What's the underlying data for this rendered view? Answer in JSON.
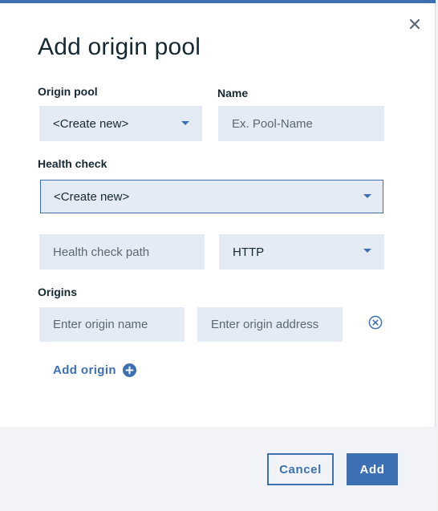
{
  "modal": {
    "title": "Add origin pool",
    "close_icon": "close-icon"
  },
  "form": {
    "origin_pool_label": "Origin pool",
    "origin_pool_value": "<Create new>",
    "name_label": "Name",
    "name_placeholder": "Ex. Pool-Name",
    "health_check_label": "Health check",
    "health_check_value": "<Create new>",
    "health_check_path_placeholder": "Health check path",
    "protocol_value": "HTTP",
    "origins_label": "Origins",
    "origin_name_placeholder": "Enter origin name",
    "origin_address_placeholder": "Enter origin address",
    "remove_origin_icon": "close-circle-icon",
    "add_origin_label": "Add origin",
    "add_origin_icon": "add-circle-icon"
  },
  "footer": {
    "cancel_label": "Cancel",
    "add_label": "Add"
  },
  "colors": {
    "accent": "#3d70b2",
    "field_bg": "#e4ebf4",
    "text": "#152935",
    "placeholder": "#5a6872"
  }
}
